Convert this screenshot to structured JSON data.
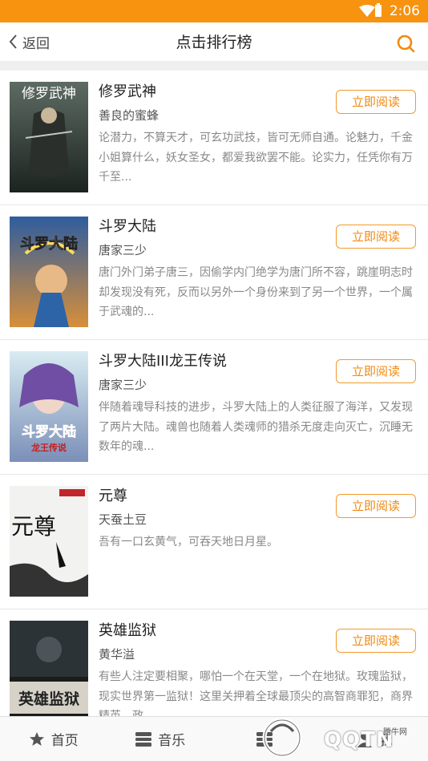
{
  "status_bar": {
    "time": "2:06"
  },
  "nav": {
    "back_label": "返回",
    "title": "点击排行榜"
  },
  "accent_color": "#f7930f",
  "books": [
    {
      "title": "修罗武神",
      "author": "善良的蜜蜂",
      "description": "论潜力，不算天才，可玄功武技，皆可无师自通。论魅力，千金小姐算什么，妖女圣女，都爱我欲罢不能。论实力，任凭你有万千至...",
      "button": "立即阅读",
      "cover_text": "修罗武神"
    },
    {
      "title": "斗罗大陆",
      "author": "唐家三少",
      "description": "唐门外门弟子唐三，因偷学内门绝学为唐门所不容，跳崖明志时却发现没有死，反而以另外一个身份来到了另一个世界，一个属于武魂的...",
      "button": "立即阅读",
      "cover_text": "斗罗大陆"
    },
    {
      "title": "斗罗大陆III龙王传说",
      "author": "唐家三少",
      "description": "伴随着魂导科技的进步，斗罗大陆上的人类征服了海洋，又发现了两片大陆。魂兽也随着人类魂师的猎杀无度走向灭亡，沉睡无数年的魂...",
      "button": "立即阅读",
      "cover_text": "斗罗大陆",
      "cover_subtext": "龙王传说"
    },
    {
      "title": "元尊",
      "author": "天蚕土豆",
      "description": "吾有一口玄黄气，可吞天地日月星。",
      "button": "立即阅读",
      "cover_text": "元尊"
    },
    {
      "title": "英雄监狱",
      "author": "黄华溢",
      "description": "有些人注定要相聚，哪怕一个在天堂，一个在地狱。玫瑰监狱，现实世界第一监狱！这里关押着全球最顶尖的高智商罪犯，商界精英，政...",
      "button": "立即阅读",
      "cover_text": "英雄监狱"
    }
  ],
  "tabs": [
    {
      "label": "首页",
      "icon": "star-icon"
    },
    {
      "label": "音乐",
      "icon": "music-list-icon"
    },
    {
      "label": "",
      "icon": "list-icon"
    },
    {
      "label": "我",
      "icon": "user-icon"
    }
  ],
  "watermark": {
    "text": "QQTN",
    "small": "腾牛网"
  }
}
